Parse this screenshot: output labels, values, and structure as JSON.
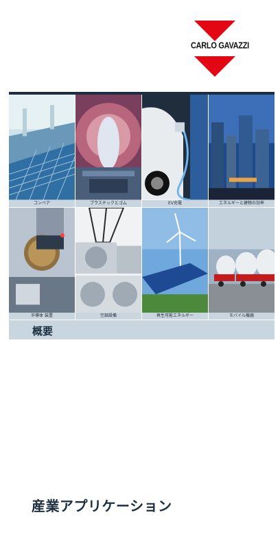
{
  "logo": {
    "text": "CARLO GAVAZZI",
    "color": "#e30613"
  },
  "tiles": [
    {
      "caption": "コンベア",
      "icon": "conveyor-image"
    },
    {
      "caption": "プラスチックとゴム",
      "icon": "plastic-rubber-image"
    },
    {
      "caption": "EV充電",
      "icon": "ev-charging-image"
    },
    {
      "caption": "エネルギーと建物の効率",
      "icon": "building-efficiency-image"
    },
    {
      "caption": "半導体 装置",
      "icon": "semiconductor-image"
    },
    {
      "caption": "空調設備",
      "icon": "hvac-image"
    },
    {
      "caption": "再生可能エネルギー",
      "icon": "renewable-energy-image"
    },
    {
      "caption": "モバイル機器",
      "icon": "mobile-equipment-image"
    }
  ],
  "section": {
    "title": "概要"
  },
  "document": {
    "title": "産業アプリケーション"
  },
  "colors": {
    "navy": "#1c2e40",
    "caption_bg": "#c9d6e0",
    "brand_red": "#e30613"
  }
}
